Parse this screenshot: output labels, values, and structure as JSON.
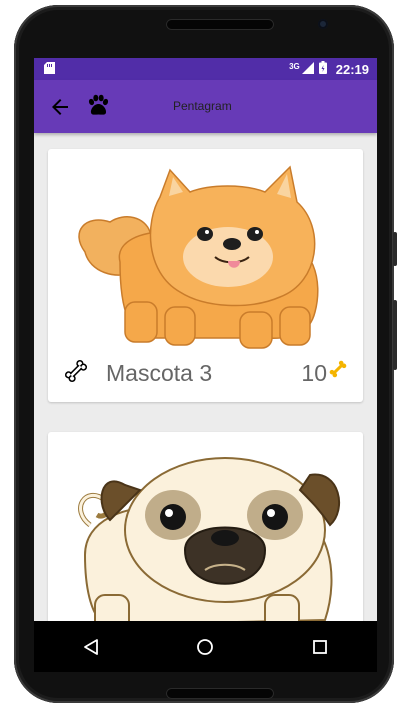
{
  "status_bar": {
    "network": "3G",
    "time": "22:19"
  },
  "app_bar": {
    "title": "Pentagram",
    "back_icon": "arrow-back-icon",
    "logo_icon": "paw-icon"
  },
  "pets": [
    {
      "name": "Mascota 3",
      "likes": "10",
      "image": "pomeranian-dog"
    },
    {
      "name": "",
      "likes": "",
      "image": "pug-dog"
    }
  ],
  "navigation": {
    "buttons": [
      "back-triangle-icon",
      "home-circle-icon",
      "recents-square-icon"
    ]
  },
  "colors": {
    "status_bar": "#512da8",
    "app_bar": "#673ab7",
    "screen_background": "#ececec",
    "card_text": "#666666",
    "gold_bone": "#f4b400"
  }
}
